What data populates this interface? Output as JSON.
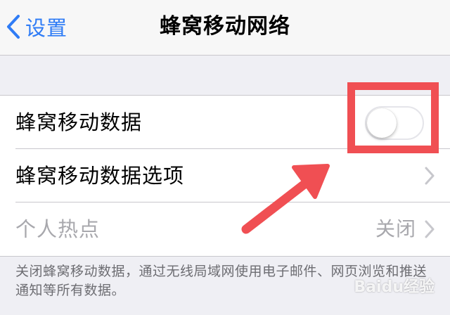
{
  "colors": {
    "accent": "#2f7cf6",
    "annotation": "#f04f53",
    "secondary_text": "#a8a8ad",
    "background": "#efeff4"
  },
  "nav": {
    "back_label": "设置",
    "back_icon": "chevron-left-icon",
    "title": "蜂窝移动网络"
  },
  "rows": [
    {
      "label": "蜂窝移动数据",
      "control": "toggle",
      "toggle_on": false
    },
    {
      "label": "蜂窝移动数据选项",
      "control": "chevron",
      "icon": "chevron-right-icon"
    },
    {
      "label": "个人热点",
      "value": "关闭",
      "control": "chevron",
      "icon": "chevron-right-icon",
      "disabled": true
    }
  ],
  "footer_note": "关闭蜂窝移动数据，通过无线局域网使用电子邮件、网页浏览和推送通知等所有数据。",
  "watermark": "Baidu经验"
}
